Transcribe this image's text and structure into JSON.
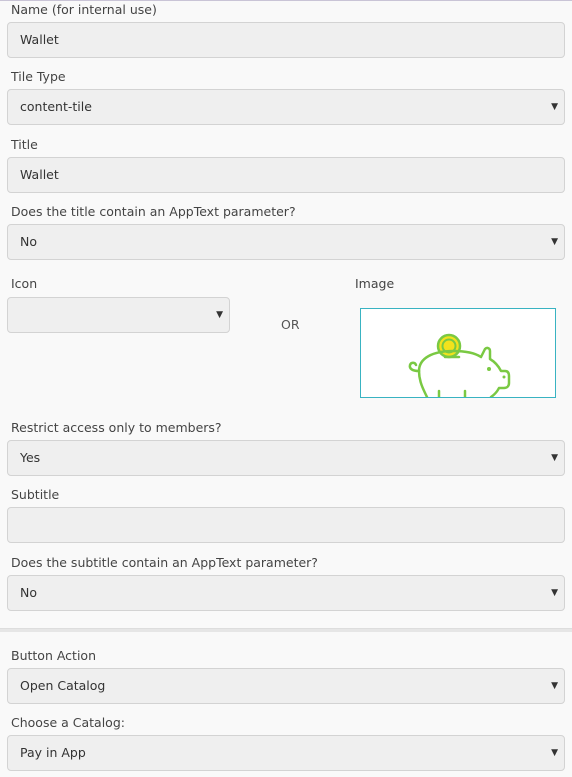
{
  "form": {
    "name": {
      "label": "Name (for internal use)",
      "value": "Wallet"
    },
    "tile_type": {
      "label": "Tile Type",
      "value": "content-tile"
    },
    "title": {
      "label": "Title",
      "value": "Wallet"
    },
    "title_apptext": {
      "label": "Does the title contain an AppText parameter?",
      "value": "No"
    },
    "icon": {
      "label": "Icon",
      "value": ""
    },
    "or_text": "OR",
    "image": {
      "label": "Image",
      "icon": "piggy-bank-icon"
    },
    "restrict_access": {
      "label": "Restrict access only to members?",
      "value": "Yes"
    },
    "subtitle": {
      "label": "Subtitle",
      "value": ""
    },
    "subtitle_apptext": {
      "label": "Does the subtitle contain an AppText parameter?",
      "value": "No"
    },
    "button_action": {
      "label": "Button Action",
      "value": "Open Catalog"
    },
    "catalog": {
      "label": "Choose a Catalog:",
      "value": "Pay in App"
    }
  },
  "icons": {
    "dropdown_caret": "caret-down-icon"
  },
  "colors": {
    "field_background": "#efefef",
    "field_border": "#d3d3d3",
    "image_border": "#39b3c2",
    "piggy_green": "#7ac943",
    "coin_yellow": "#f2e21c"
  }
}
